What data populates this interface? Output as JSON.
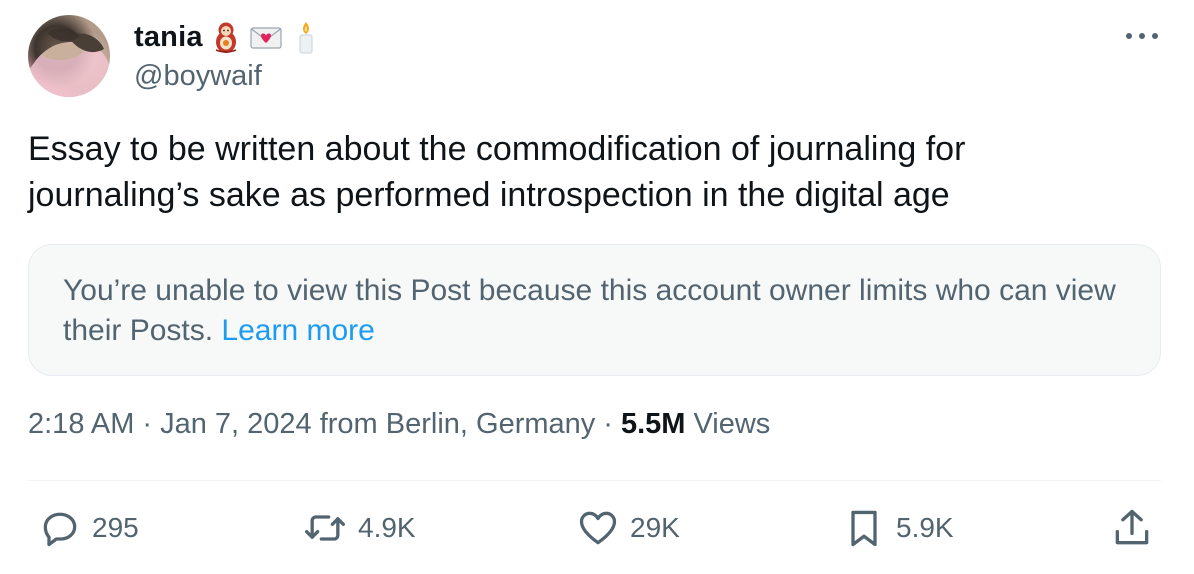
{
  "author": {
    "display_name": "tania",
    "handle": "@boywaif",
    "name_emojis": [
      "nesting-doll-icon",
      "love-letter-icon",
      "candle-icon"
    ]
  },
  "tweet": {
    "text": "Essay to be written about the commodification of journaling for\njournaling’s sake as performed introspection in the digital age"
  },
  "quoted_notice": {
    "message": "You’re unable to view this Post because this account owner limits who can view their Posts.",
    "link_label": "Learn more"
  },
  "meta": {
    "time": "2:18 AM",
    "separator": "·",
    "date_location": "Jan 7, 2024 from Berlin, Germany",
    "views_count": "5.5M",
    "views_label": "Views"
  },
  "actions": {
    "replies": "295",
    "reposts": "4.9K",
    "likes": "29K",
    "bookmarks": "5.9K"
  },
  "colors": {
    "text_primary": "#0f1419",
    "text_secondary": "#536471",
    "link": "#1d9bf0",
    "notice_bg": "#f7f9f9"
  }
}
